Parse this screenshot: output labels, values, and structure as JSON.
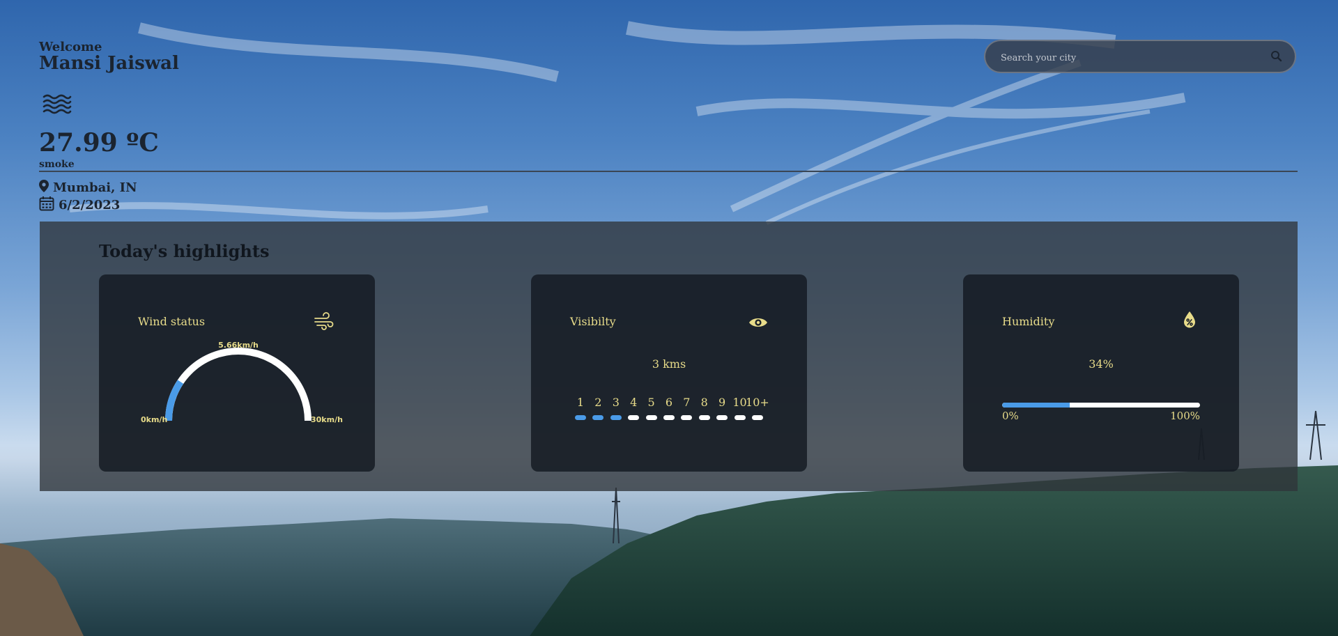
{
  "header": {
    "welcome": "Welcome",
    "user_name": "Mansi Jaiswal",
    "weather_icon": "haze-waves-icon",
    "temperature": "27.99 ºC",
    "condition": "smoke",
    "location": "Mumbai, IN",
    "date": "6/2/2023"
  },
  "search": {
    "placeholder": "Search your city",
    "icon": "search-icon"
  },
  "highlights": {
    "title": "Today's highlights",
    "wind": {
      "label": "Wind status",
      "icon": "wind-icon",
      "current": "5.66km/h",
      "min": "0km/h",
      "max": "30km/h",
      "value": 5.66,
      "max_value": 30
    },
    "visibility": {
      "label": "Visibilty",
      "icon": "eye-icon",
      "value": "3 kms",
      "scale": [
        "1",
        "2",
        "3",
        "4",
        "5",
        "6",
        "7",
        "8",
        "9",
        "10",
        "10+"
      ],
      "active_count": 3
    },
    "humidity": {
      "label": "Humidity",
      "icon": "humidity-drop-icon",
      "value": "34%",
      "percent": 34,
      "min": "0%",
      "max": "100%"
    }
  },
  "colors": {
    "accent_blue": "#4a9be8",
    "label_yellow": "#e8dc8a",
    "text_dark": "#1b2430"
  }
}
